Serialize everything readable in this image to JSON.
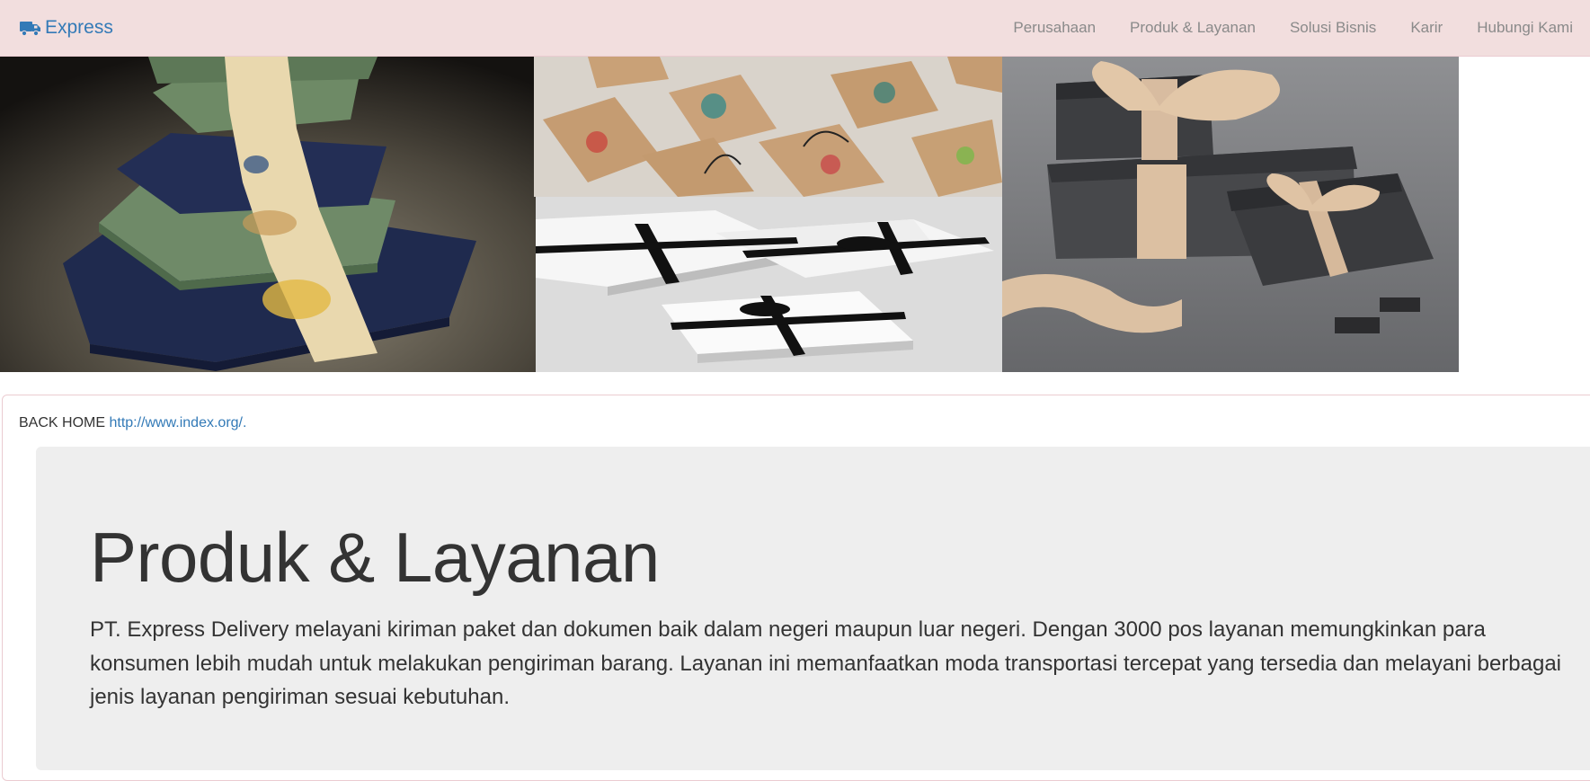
{
  "navbar": {
    "brand_icon": "truck-icon",
    "brand_label": "Express",
    "brand_color": "#337ab7",
    "background": "#f2dede",
    "links": [
      "Perusahaan",
      "Produk & Layanan",
      "Solusi Bisnis",
      "Karir",
      "Hubungi Kami"
    ]
  },
  "banner": {
    "images": [
      "stacked-gift-boxes-photo",
      "kraft-boxes-flower-print-photo",
      "white-boxes-black-ribbon-photo",
      "grey-boxes-satin-ribbon-photo"
    ]
  },
  "back_home": {
    "label": "BACK HOME",
    "link_text": "http://www.index.org/."
  },
  "jumbotron": {
    "title": "Produk & Layanan",
    "text": "PT. Express Delivery melayani kiriman paket dan dokumen baik dalam negeri maupun luar negeri. Dengan 3000 pos layanan memungkinkan para konsumen lebih mudah untuk melakukan pengiriman barang. Layanan ini memanfaatkan moda transportasi tercepat yang tersedia dan melayani berbagai jenis layanan pengiriman sesuai kebutuhan."
  }
}
